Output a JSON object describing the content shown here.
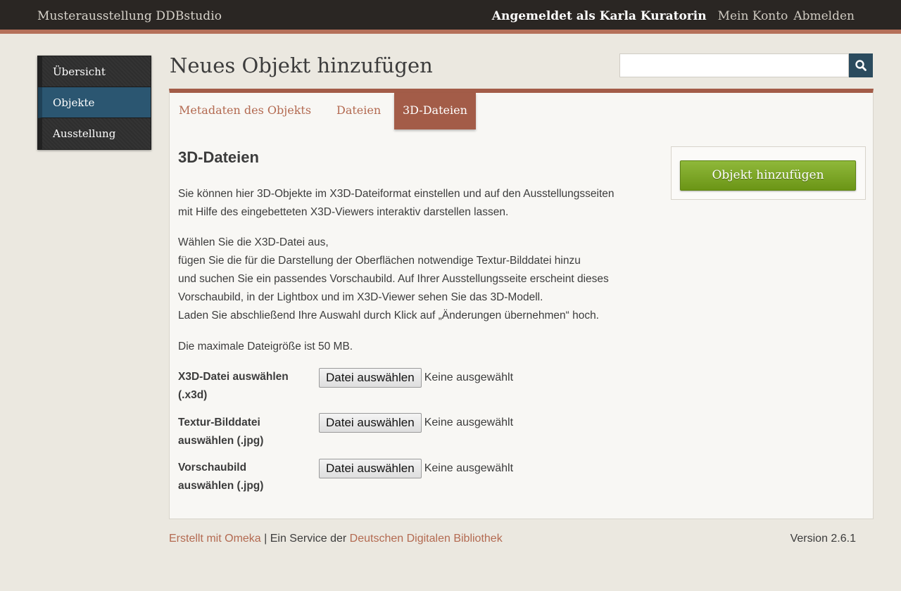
{
  "header": {
    "site_title": "Musterausstellung DDBstudio",
    "logged_in_as": "Angemeldet als Karla Kuratorin",
    "account_link": "Mein Konto",
    "logout_link": "Abmelden"
  },
  "sidebar": {
    "items": [
      {
        "label": "Übersicht",
        "active": false
      },
      {
        "label": "Objekte",
        "active": true
      },
      {
        "label": "Ausstellung",
        "active": false
      }
    ]
  },
  "page": {
    "title": "Neues Objekt hinzufügen"
  },
  "search": {
    "value": "",
    "icon": "search-icon"
  },
  "tabs": [
    {
      "label": "Metadaten des Objekts",
      "active": false
    },
    {
      "label": "Dateien",
      "active": false
    },
    {
      "label": "3D-Dateien",
      "active": true
    }
  ],
  "content": {
    "section_title": "3D-Dateien",
    "intro_lines": [
      "Sie können hier 3D-Objekte im X3D-Dateiformat einstellen und auf den Ausstellungsseiten",
      "mit Hilfe des eingebetteten X3D-Viewers interaktiv darstellen lassen."
    ],
    "instruction_lines": [
      "Wählen Sie die X3D-Datei aus,",
      "fügen Sie die für die Darstellung der Oberflächen notwendige Textur-Bilddatei hinzu",
      "und suchen Sie ein passendes Vorschaubild. Auf Ihrer Ausstellungsseite erscheint dieses",
      "Vorschaubild, in der Lightbox und im X3D-Viewer sehen Sie das 3D-Modell.",
      "Laden Sie abschließend Ihre Auswahl durch Klick auf „Änderungen übernehmen“ hoch."
    ],
    "max_size": "Die maximale Dateigröße ist 50 MB.",
    "fields": [
      {
        "label_line1": "X3D-Datei auswählen",
        "label_line2": "(.x3d)",
        "button": "Datei auswählen",
        "status": "Keine ausgewählt"
      },
      {
        "label_line1": "Textur-Bilddatei",
        "label_line2": "auswählen (.jpg)",
        "button": "Datei auswählen",
        "status": "Keine ausgewählt"
      },
      {
        "label_line1": "Vorschaubild",
        "label_line2": "auswählen (.jpg)",
        "button": "Datei auswählen",
        "status": "Keine ausgewählt"
      }
    ]
  },
  "save": {
    "label": "Objekt hinzufügen"
  },
  "footer": {
    "made_with": "Erstellt mit Omeka",
    "separator": " | Ein Service der ",
    "ddb_link": "Deutschen Digitalen Bibliothek",
    "version": "Version 2.6.1"
  },
  "colors": {
    "topbar": "#2a2623",
    "accent": "#a35c48",
    "link": "#b36a51",
    "nav_active": "#2b5671",
    "save_button": "#7aa423",
    "search_button": "#2b4b5e"
  }
}
